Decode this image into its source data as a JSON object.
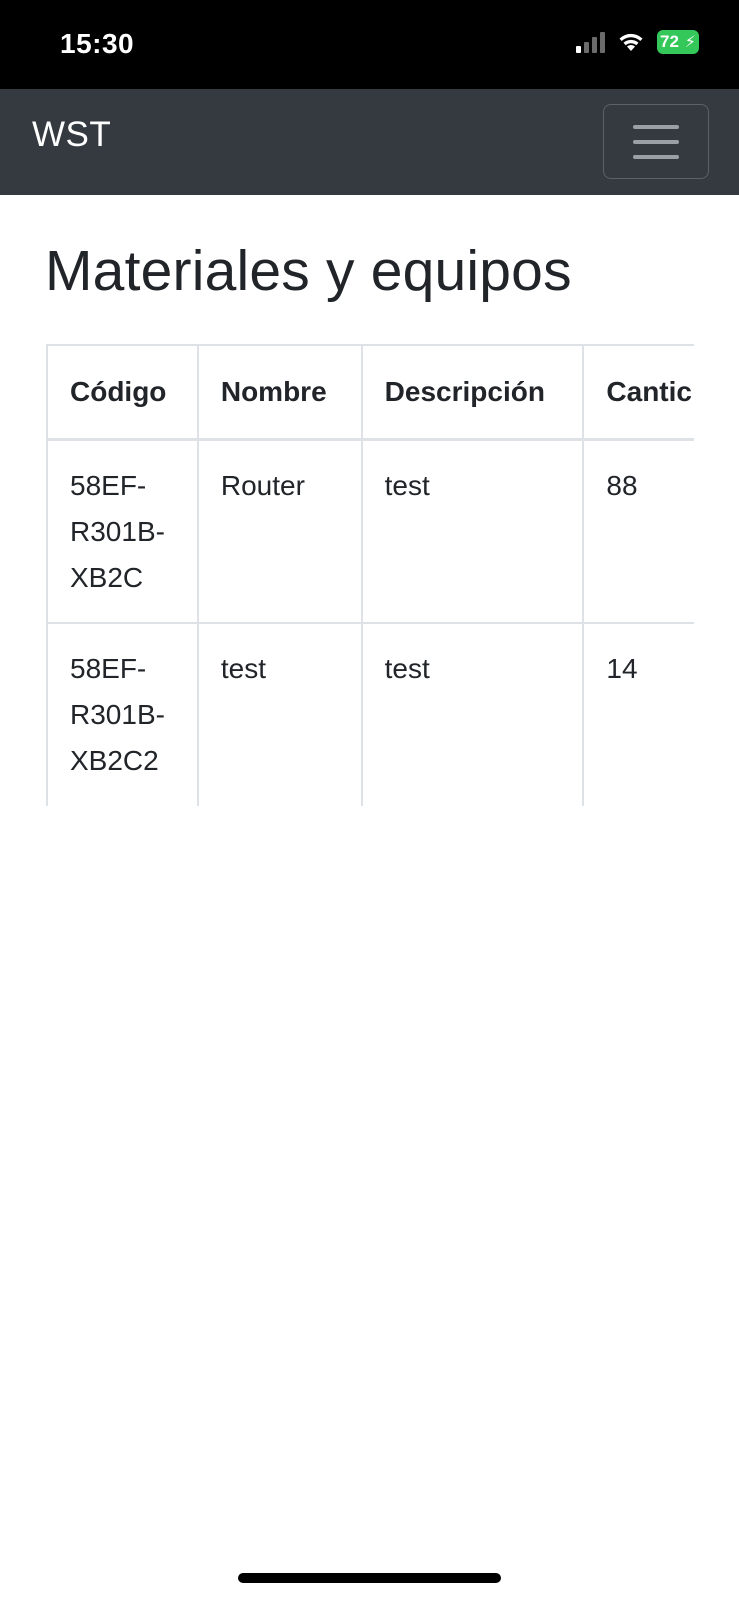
{
  "status_bar": {
    "time": "15:30",
    "battery_level": "72",
    "signal_bars_active": 1,
    "signal_bars_total": 4,
    "icons": [
      "signal-icon",
      "wifi-icon",
      "battery-icon",
      "charging-bolt-icon"
    ],
    "battery_color": "#34c759"
  },
  "navbar": {
    "brand": "WST",
    "background": "#343a40",
    "toggler_icon": "menu-icon"
  },
  "main": {
    "title": "Materiales y equipos",
    "table": {
      "headers": [
        "Código",
        "Nombre",
        "Descripción",
        "Cantic"
      ],
      "rows": [
        {
          "codigo": "58EF-R301B-XB2C",
          "nombre": "Router",
          "descripcion": "test",
          "cantidad": "88"
        },
        {
          "codigo": "58EF-R301B-XB2C2",
          "nombre": "test",
          "descripcion": "test",
          "cantidad": "14"
        }
      ]
    }
  }
}
